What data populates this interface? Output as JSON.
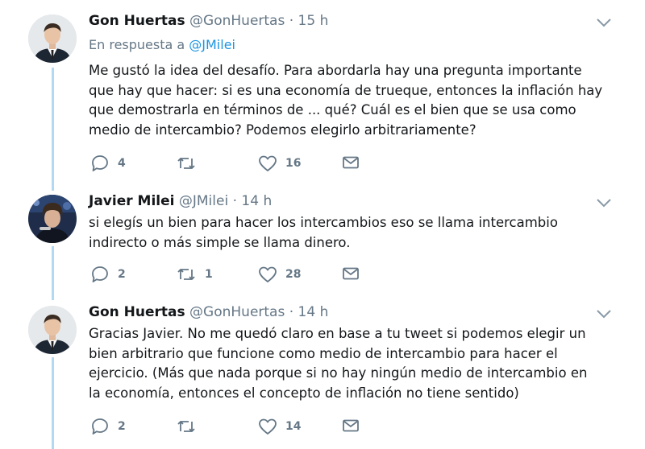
{
  "tweets": [
    {
      "name": "Gon Huertas",
      "handle": "@GonHuertas",
      "separator": "·",
      "time": "15 h",
      "reply_prefix": "En respuesta a",
      "reply_to": "@JMilei",
      "text": "Me gustó la idea del desafío. Para abordarla hay una pregunta importante\nque hay que hacer: si es una economía de trueque, entonces la inflación hay\nque demostrarla en términos de ... qué? Cuál es el bien que se usa como\nmedio de intercambio? Podemos elegirlo arbitrariamente?",
      "replies": "4",
      "retweets": "",
      "likes": "16",
      "icons": [
        "reply-icon",
        "retweet-icon",
        "like-icon",
        "direct-message-icon",
        "chevron-down-icon"
      ]
    },
    {
      "name": "Javier Milei",
      "handle": "@JMilei",
      "separator": "·",
      "time": "14 h",
      "text": "si elegís un bien para hacer los intercambios eso se llama intercambio\nindirecto o más simple se llama dinero.",
      "replies": "2",
      "retweets": "1",
      "likes": "28",
      "icons": [
        "reply-icon",
        "retweet-icon",
        "like-icon",
        "direct-message-icon",
        "chevron-down-icon"
      ]
    },
    {
      "name": "Gon Huertas",
      "handle": "@GonHuertas",
      "separator": "·",
      "time": "14 h",
      "text": "Gracias Javier. No me quedó claro en base a tu tweet si podemos elegir un\nbien arbitrario que funcione como medio de intercambio para hacer el\nejercicio. (Más que nada porque si no hay ningún medio de intercambio en\nla economía, entonces el concepto de inflación no tiene sentido)",
      "replies": "2",
      "retweets": "",
      "likes": "14",
      "icons": [
        "reply-icon",
        "retweet-icon",
        "like-icon",
        "direct-message-icon",
        "chevron-down-icon"
      ]
    }
  ],
  "colors": {
    "thread_line": "#b3d9f2",
    "link": "#1b95e0",
    "secondary_text": "#657786",
    "primary_text": "#14171a"
  }
}
